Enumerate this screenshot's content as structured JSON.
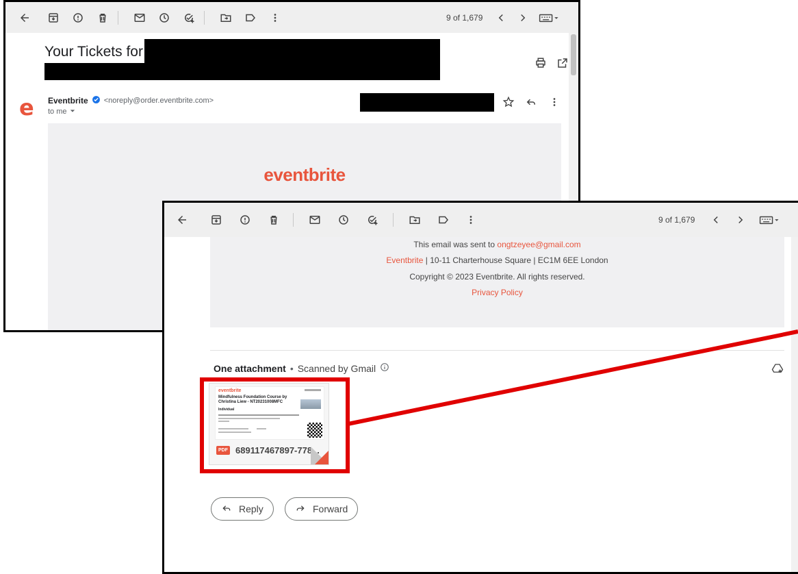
{
  "toolbar": {
    "count": "9 of 1,679"
  },
  "email": {
    "subject": "Your Tickets for",
    "sender_name": "Eventbrite",
    "sender_email": "<noreply@order.eventbrite.com>",
    "recipient": "to me",
    "avatar_letter": "e",
    "brand_logo": "eventbrite"
  },
  "footer": {
    "sent_prefix": "This email was sent to ",
    "sent_email": "ongtzeyee@gmail.com",
    "brand_link": "Eventbrite",
    "address": " | 10-11 Charterhouse Square | EC1M 6EE London",
    "copyright": "Copyright © 2023 Eventbrite. All rights reserved.",
    "privacy": "Privacy Policy"
  },
  "attachments": {
    "heading": "One attachment",
    "scanned": "Scanned by Gmail",
    "file_name": "689117467897-778...",
    "file_type": "PDF",
    "preview": {
      "brand": "eventbrite",
      "title": "Mindfulness Foundation Course by Christina Liew - NT20231008MFC",
      "ticket_type": "Individual"
    }
  },
  "actions": {
    "reply": "Reply",
    "forward": "Forward"
  },
  "colors": {
    "brand": "#e8553d",
    "verified": "#1a73e8",
    "highlight": "#e00000"
  }
}
